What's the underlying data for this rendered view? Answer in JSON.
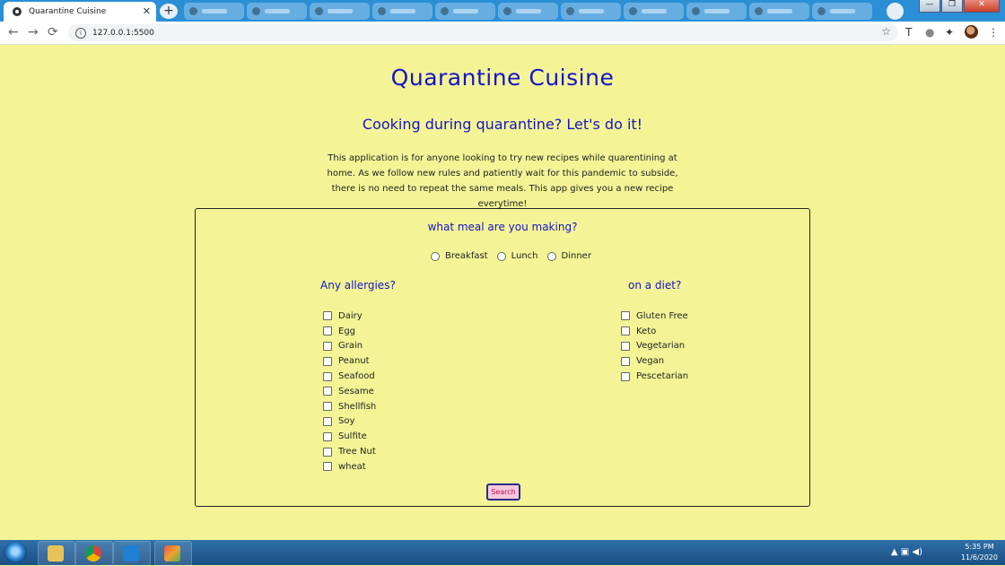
{
  "browser": {
    "tab_title": "Quarantine Cuisine",
    "tab_close": "✕",
    "new_tab": "+",
    "url": "127.0.0.1:5500",
    "back": "←",
    "forward": "→",
    "reload": "⟳",
    "star": "☆",
    "window_minimize": "—",
    "window_restore": "❐",
    "window_close": "✕",
    "extensions": [
      "T",
      "●",
      "✦",
      "⋮"
    ]
  },
  "page": {
    "title": "Quarantine Cuisine",
    "subtitle": "Cooking during quarantine? Let's do it!",
    "description": "This application is for anyone looking to try new recipes while quarentining at home. As we follow new rules and patiently wait for this pandemic to subside, there is no need to repeat the same meals. This app gives you a new recipe everytime!",
    "meal_question": "what meal are you making?",
    "meals": [
      "Breakfast",
      "Lunch",
      "Dinner"
    ],
    "allergies_title": "Any allergies?",
    "allergies": [
      "Dairy",
      "Egg",
      "Grain",
      "Peanut",
      "Seafood",
      "Sesame",
      "Shellfish",
      "Soy",
      "Sulfite",
      "Tree Nut",
      "wheat"
    ],
    "diet_title": "on a diet?",
    "diets": [
      "Gluten Free",
      "Keto",
      "Vegetarian",
      "Vegan",
      "Pescetarian"
    ],
    "search_label": "Search"
  },
  "taskbar": {
    "time": "5:35 PM",
    "date": "11/6/2020",
    "tray_icons": "▲ ▣ ◀)"
  }
}
